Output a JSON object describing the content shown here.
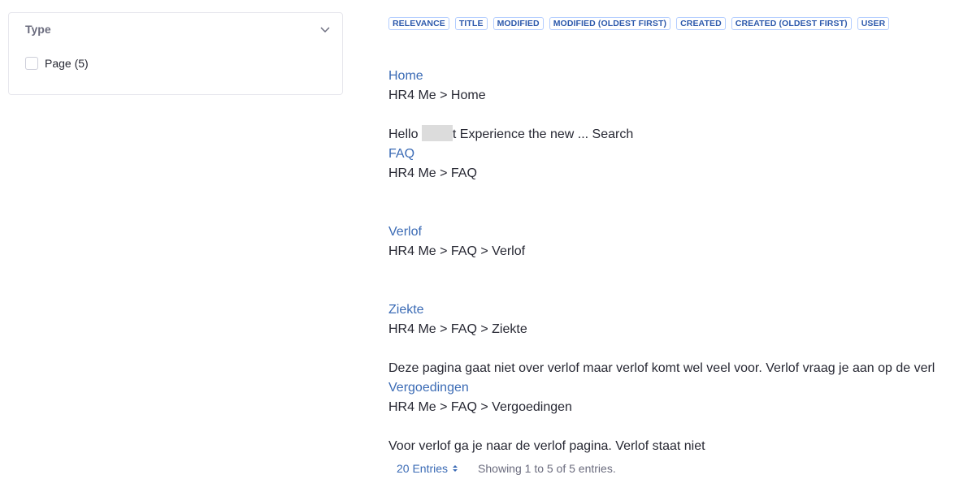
{
  "filter": {
    "title": "Type",
    "options": [
      {
        "label": "Page (5)",
        "checked": false
      }
    ]
  },
  "sort_options": [
    "RELEVANCE",
    "TITLE",
    "MODIFIED",
    "MODIFIED (OLDEST FIRST)",
    "CREATED",
    "CREATED (OLDEST FIRST)",
    "USER"
  ],
  "results": [
    {
      "title": "Home",
      "path": "HR4 Me > Home",
      "snippet_prefix": "Hello ",
      "snippet_suffix": "t Experience the new ... Search"
    },
    {
      "title": "FAQ",
      "path": "HR4 Me > FAQ",
      "snippet": ""
    },
    {
      "title": "Verlof",
      "path": "HR4 Me > FAQ > Verlof",
      "snippet": ""
    },
    {
      "title": "Ziekte",
      "path": "HR4 Me > FAQ > Ziekte",
      "snippet": "Deze pagina gaat niet over verlof maar verlof komt wel veel voor. Verlof vraag je aan op de verl"
    },
    {
      "title": "Vergoedingen",
      "path": "HR4 Me > FAQ > Vergoedingen",
      "snippet": "Voor verlof ga je naar de verlof pagina. Verlof staat niet"
    }
  ],
  "pagination": {
    "entries_label": "20 Entries",
    "showing": "Showing 1 to 5 of 5 entries."
  },
  "colors": {
    "link": "#3b6bb5",
    "pill_text": "#2e5aac",
    "pill_border": "#b3cdff"
  }
}
